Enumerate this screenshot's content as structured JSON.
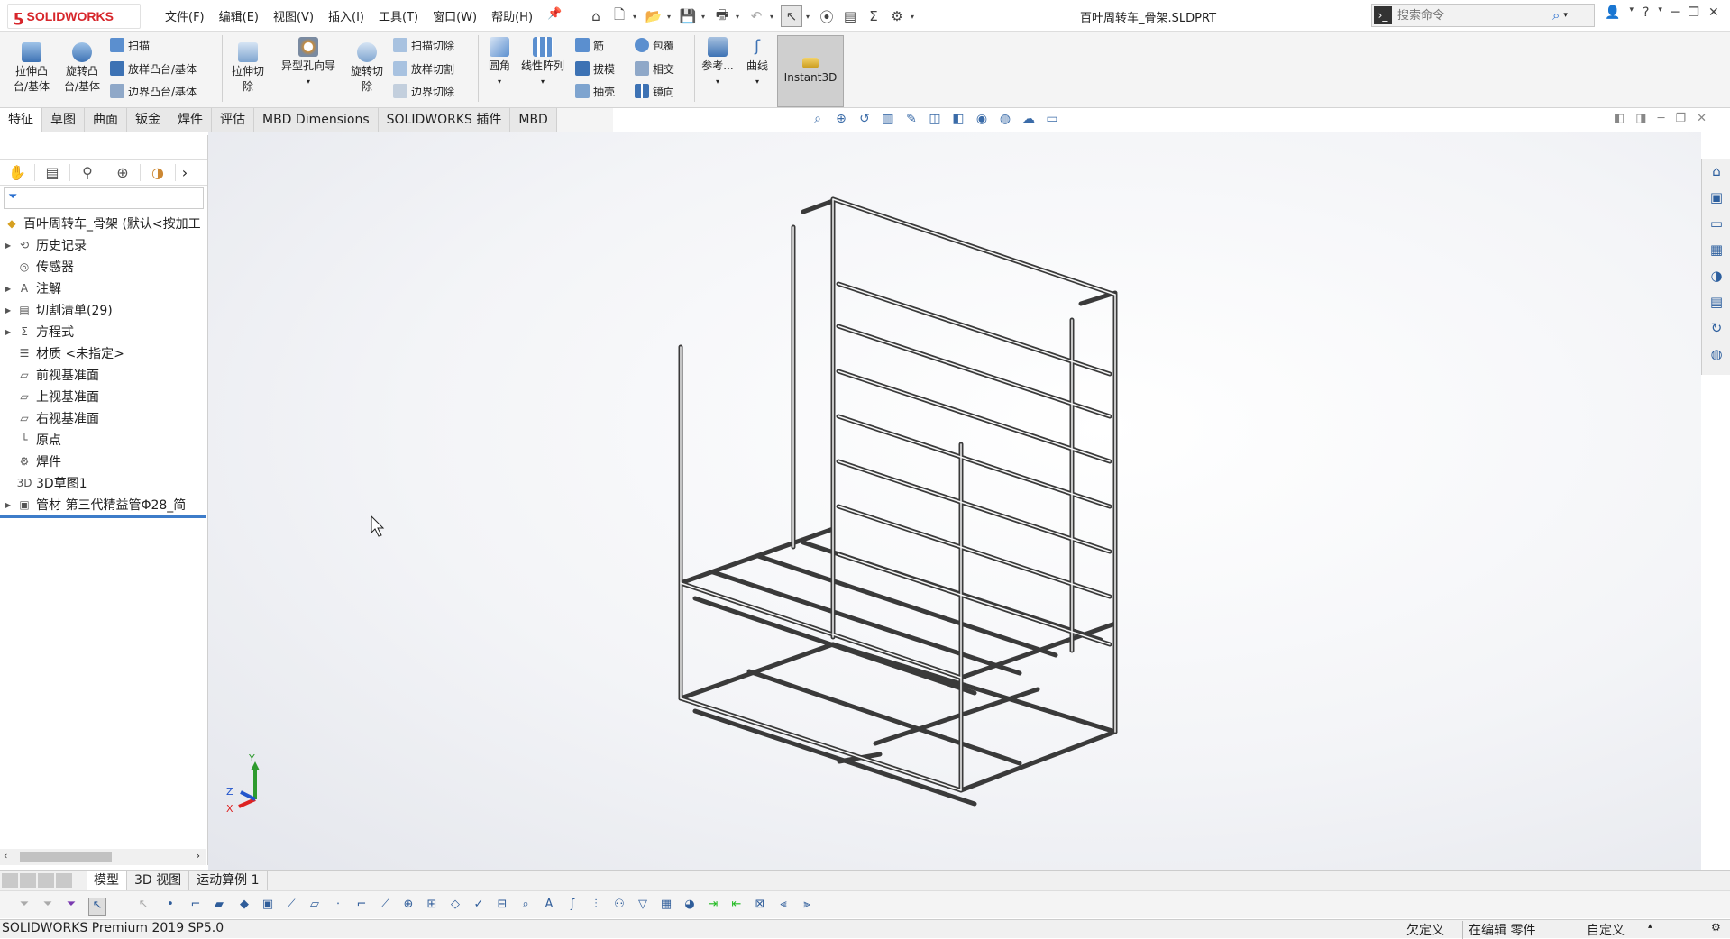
{
  "app": {
    "logo_text": "SOLIDWORKS",
    "doc_title": "百叶周转车_骨架.SLDPRT"
  },
  "menu": [
    "文件(F)",
    "编辑(E)",
    "视图(V)",
    "插入(I)",
    "工具(T)",
    "窗口(W)",
    "帮助(H)"
  ],
  "search": {
    "placeholder": "搜索命令"
  },
  "ribbon": {
    "extrude_boss": "拉伸凸\n台/基体",
    "revolve_boss": "旋转凸\n台/基体",
    "sweep": "扫描",
    "loft": "放样凸台/基体",
    "boundary": "边界凸台/基体",
    "extrude_cut": "拉伸切\n除",
    "hole_wizard": "异型孔向导",
    "revolve_cut": "旋转切\n除",
    "swept_cut": "扫描切除",
    "lofted_cut": "放样切割",
    "boundary_cut": "边界切除",
    "fillet": "圆角",
    "linear_pattern": "线性阵列",
    "rib": "筋",
    "draft": "拔模",
    "shell": "抽壳",
    "wrap": "包覆",
    "intersect": "相交",
    "mirror": "镜向",
    "reference": "参考...",
    "curves": "曲线",
    "instant3d": "Instant3D"
  },
  "tabs": [
    "特征",
    "草图",
    "曲面",
    "钣金",
    "焊件",
    "评估",
    "MBD Dimensions",
    "SOLIDWORKS 插件",
    "MBD"
  ],
  "tree": {
    "root": "百叶周转车_骨架 (默认<按加工",
    "items": [
      {
        "label": "历史记录",
        "exp": true
      },
      {
        "label": "传感器",
        "exp": false
      },
      {
        "label": "注解",
        "exp": true
      },
      {
        "label": "切割清单(29)",
        "exp": true
      },
      {
        "label": "方程式",
        "exp": true
      },
      {
        "label": "材质 <未指定>",
        "exp": false
      },
      {
        "label": "前视基准面",
        "exp": false
      },
      {
        "label": "上视基准面",
        "exp": false
      },
      {
        "label": "右视基准面",
        "exp": false
      },
      {
        "label": "原点",
        "exp": false
      },
      {
        "label": "焊件",
        "exp": false
      },
      {
        "label": "3D草图1",
        "exp": false
      },
      {
        "label": "管材 第三代精益管Φ28_简",
        "exp": true
      }
    ]
  },
  "triad": {
    "x": "X",
    "y": "Y",
    "z": "Z"
  },
  "bottom_tabs": [
    "模型",
    "3D 视图",
    "运动算例 1"
  ],
  "status": {
    "version": "SOLIDWORKS Premium 2019 SP5.0",
    "defined": "欠定义",
    "editing": "在编辑 零件",
    "custom": "自定义"
  }
}
